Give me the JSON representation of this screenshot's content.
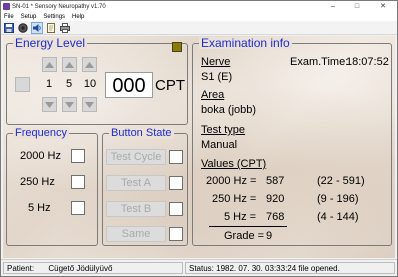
{
  "window": {
    "title": "SN-01 * Sensory Neuropathy v1.70",
    "minimize_glyph": "–",
    "maximize_glyph": "□",
    "close_glyph": "✕"
  },
  "menu": [
    "File",
    "Setup",
    "Settings",
    "Help"
  ],
  "toolbar": {
    "icons": [
      "save-icon",
      "record-icon",
      "speaker-icon",
      "document-icon",
      "print-icon"
    ]
  },
  "energy": {
    "title": "Energy Level",
    "steps": [
      "1",
      "5",
      "10"
    ],
    "value": "000",
    "unit": "CPT",
    "led_color": "#8a7a12"
  },
  "frequency": {
    "title": "Frequency",
    "options": [
      "2000 Hz",
      "250 Hz",
      "5 Hz"
    ]
  },
  "button_state": {
    "title": "Button State",
    "buttons": [
      "Test Cycle",
      "Test A",
      "Test B",
      "Same"
    ]
  },
  "exam": {
    "title": "Examination info",
    "nerve_label": "Nerve",
    "exam_time_label": "Exam.Time:",
    "exam_time": "18:07:52",
    "nerve_value": "S1 (E)",
    "area_label": "Area",
    "area_value": "boka (jobb)",
    "test_type_label": "Test type",
    "test_type_value": "Manual",
    "values_label": "Values (CPT)",
    "values": [
      {
        "freq": "2000 Hz =",
        "value": "587",
        "range": "(22 - 591)"
      },
      {
        "freq": "250 Hz =",
        "value": "920",
        "range": "(9 - 196)"
      },
      {
        "freq": "5 Hz =",
        "value": "768",
        "range": "(4 - 144)"
      }
    ],
    "grade_label": "Grade =",
    "grade_value": "9"
  },
  "status": {
    "patient_label": "Patient:",
    "patient_name": "Cügető Jödülyüvő",
    "message": "Status: 1982. 07. 30. 03:33:24  file opened."
  },
  "colors": {
    "group_title": "#1a2cd6",
    "accent": "#1a2cd6"
  }
}
